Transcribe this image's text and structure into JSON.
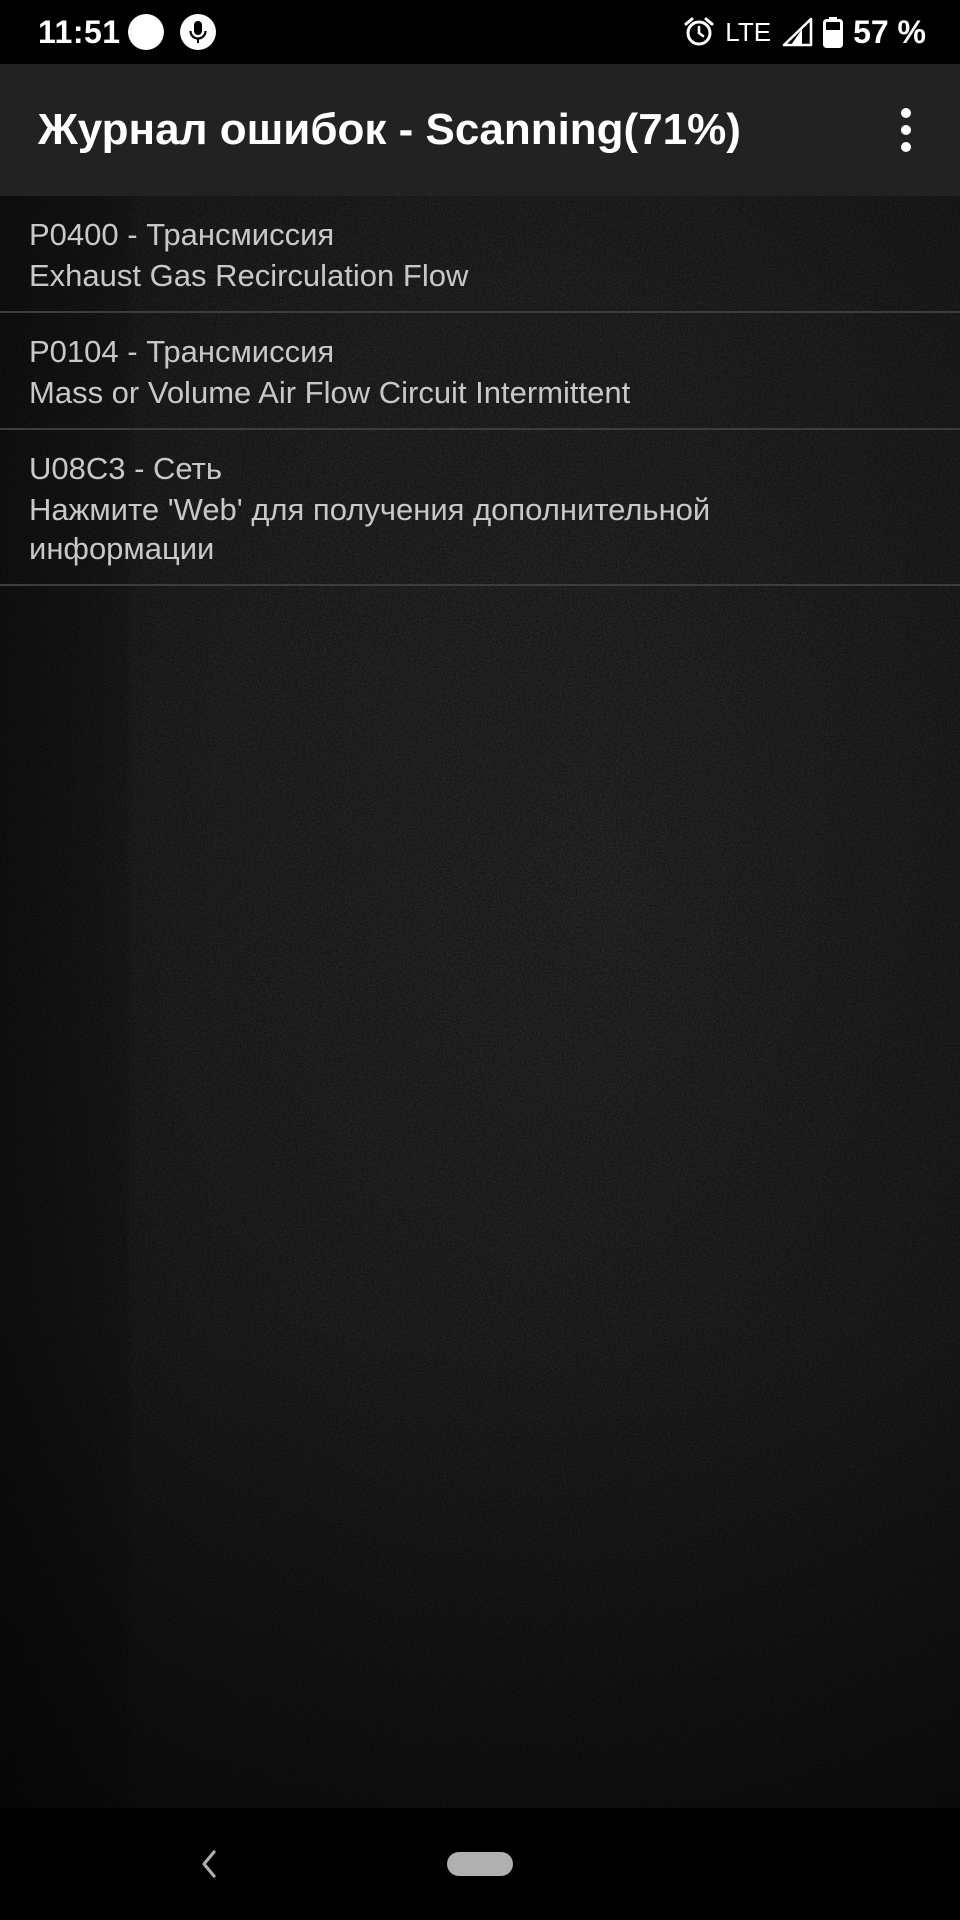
{
  "status_bar": {
    "time": "11:51",
    "network": "LTE",
    "battery": "57 %",
    "icons": [
      "notification-dot-icon",
      "mic-icon",
      "alarm-icon",
      "signal-icon",
      "battery-icon"
    ]
  },
  "app_bar": {
    "title": "Журнал ошибок - Scanning(71%)",
    "menu_icon": "overflow-menu-icon"
  },
  "dtc_list": [
    {
      "code_line": "P0400 - Трансмиссия",
      "description": "Exhaust Gas Recirculation Flow"
    },
    {
      "code_line": "P0104 - Трансмиссия",
      "description": "Mass or Volume Air Flow Circuit Intermittent"
    },
    {
      "code_line": "U08C3 - Сеть",
      "description": "Нажмите 'Web' для получения дополнительной информации"
    }
  ],
  "nav_bar": {
    "icons": [
      "back-icon",
      "home-pill-icon"
    ]
  },
  "colors": {
    "status_bar_bg": "#000000",
    "app_bar_bg": "#222222",
    "text_primary": "#ffffff",
    "list_text": "#c8c8c8",
    "divider": "#3d3d3d"
  }
}
